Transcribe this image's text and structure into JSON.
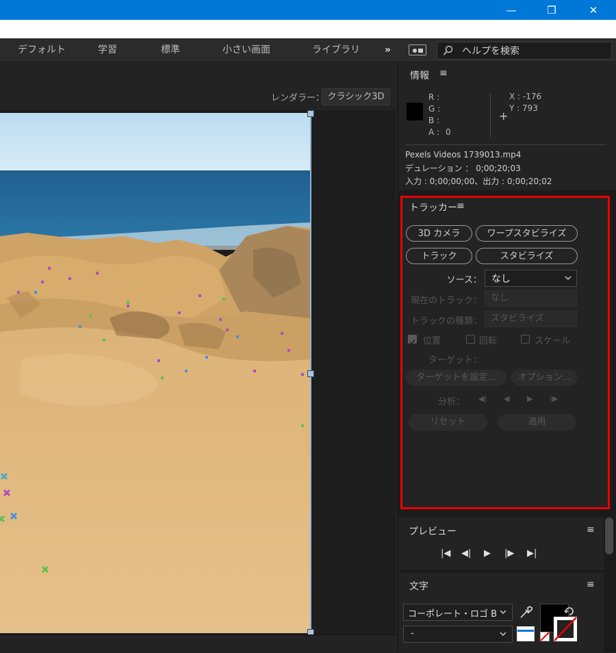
{
  "window": {
    "minimize": "—",
    "restore": "❐",
    "close": "✕"
  },
  "workspaces": [
    "デフォルト",
    "学習",
    "標準",
    "小さい画面",
    "ライブラリ"
  ],
  "workspace_more": "»",
  "search": {
    "placeholder": "ヘルプを検索"
  },
  "composition": {
    "renderer_label": "レンダラー：",
    "renderer_value": "クラシック3D"
  },
  "info": {
    "title": "情報",
    "menu": "≡",
    "r": "R :",
    "g": "G :",
    "b": "B :",
    "a": "A :",
    "a_value": "0",
    "x": "X : -176",
    "y": "Y : 793",
    "file": "Pexels Videos 1739013.mp4",
    "duration": "デュレーション ： 0;00;20;03",
    "inout": "入力 : 0;00;00;00、出力 : 0;00;20;02"
  },
  "tracker": {
    "title": "トラッカー",
    "menu": "≡",
    "camera_btn": "3D カメラ",
    "warp_btn": "ワープスタビライズ",
    "track_btn": "トラック",
    "stabilize_btn": "スタビライズ",
    "source_label": "ソース：",
    "source_value": "なし",
    "current_track_label": "現在のトラック：",
    "current_track_value": "なし",
    "track_type_label": "トラックの種類：",
    "track_type_value": "スタビライズ",
    "position": "位置",
    "rotation": "回転",
    "scale": "スケール",
    "target_label": "ターゲット：",
    "set_target_btn": "ターゲットを設定...",
    "options_btn": "オプション...",
    "analyze_label": "分析：",
    "analyze_icons": [
      "◀|",
      "◀",
      "▶",
      "|▶"
    ],
    "reset_btn": "リセット",
    "apply_btn": "適用"
  },
  "preview": {
    "title": "プレビュー",
    "menu": "≡",
    "controls": [
      "|◀",
      "◀|",
      "▶",
      "|▶",
      "▶|"
    ]
  },
  "character": {
    "title": "文字",
    "menu": "≡",
    "font": "コーポレート・ロゴ B",
    "style": "-"
  },
  "colors": {
    "accent": "#0078d7",
    "highlight": "#ee0000",
    "tracker_purple": "#b04cc0",
    "tracker_green": "#5ec24a",
    "tracker_blue": "#4a8fd8"
  }
}
